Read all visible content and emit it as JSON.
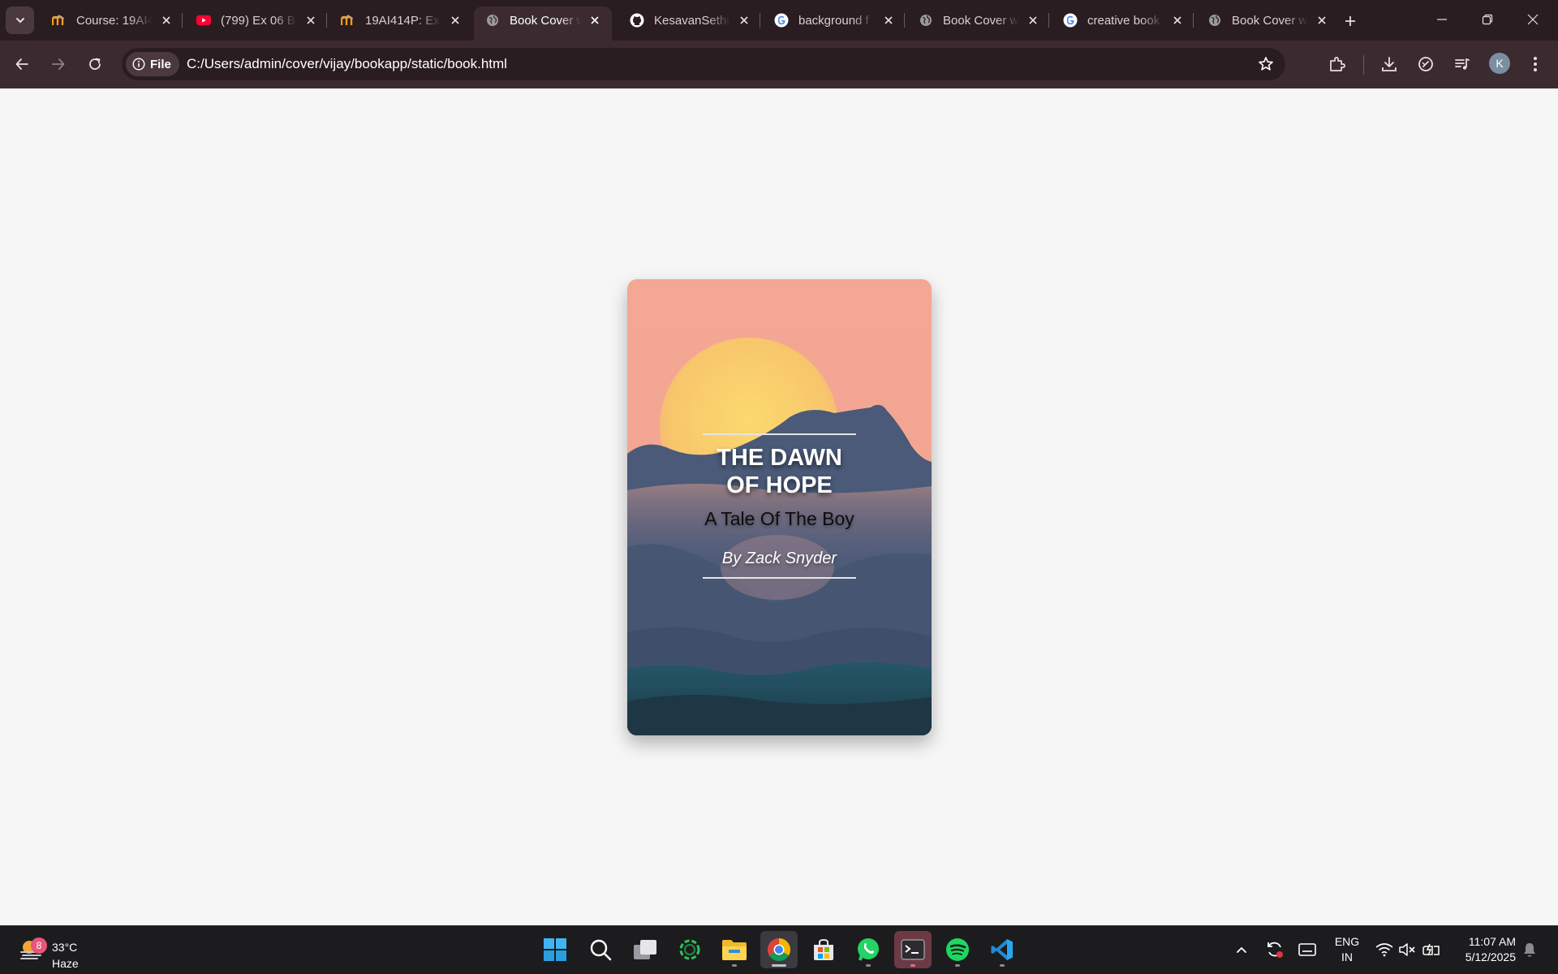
{
  "browser": {
    "tabs": [
      {
        "label": "Course: 19AI414P",
        "icon": "moodle-icon",
        "active": false
      },
      {
        "label": "(799) Ex 06 Book",
        "icon": "youtube-icon",
        "active": false
      },
      {
        "label": "19AI414P: Ex",
        "icon": "moodle-icon",
        "active": false
      },
      {
        "label": "Book Cover with",
        "icon": "globe-icon",
        "active": true
      },
      {
        "label": "KesavanSethu",
        "icon": "github-icon",
        "active": false
      },
      {
        "label": "background f",
        "icon": "google-icon",
        "active": false
      },
      {
        "label": "Book Cover w",
        "icon": "globe-icon",
        "active": false
      },
      {
        "label": "creative book",
        "icon": "google-icon",
        "active": false
      },
      {
        "label": "Book Cover w",
        "icon": "globe-icon",
        "active": false
      }
    ],
    "address": {
      "chip_label": "File",
      "url": "C:/Users/admin/cover/vijay/bookapp/static/book.html"
    },
    "profile_initial": "K"
  },
  "book": {
    "title_line1": "THE DAWN",
    "title_line2": "OF HOPE",
    "subtitle": "A Tale Of The Boy",
    "author": "By Zack Snyder"
  },
  "taskbar": {
    "weather": {
      "temp": "33°C",
      "condition": "Haze",
      "badge": "8"
    },
    "language": {
      "line1": "ENG",
      "line2": "IN"
    },
    "clock": {
      "time": "11:07 AM",
      "date": "5/12/2025"
    }
  },
  "colors": {
    "tabbar_bg": "#2a1d21",
    "toolbar_bg": "#3b2b30",
    "page_bg": "#f6f6f6",
    "sky": "#f3a794",
    "sun": "#fbd66c",
    "mountain": "#435470",
    "sea": "#1f4a5a",
    "taskbar_bg": "#1c1c1f"
  }
}
